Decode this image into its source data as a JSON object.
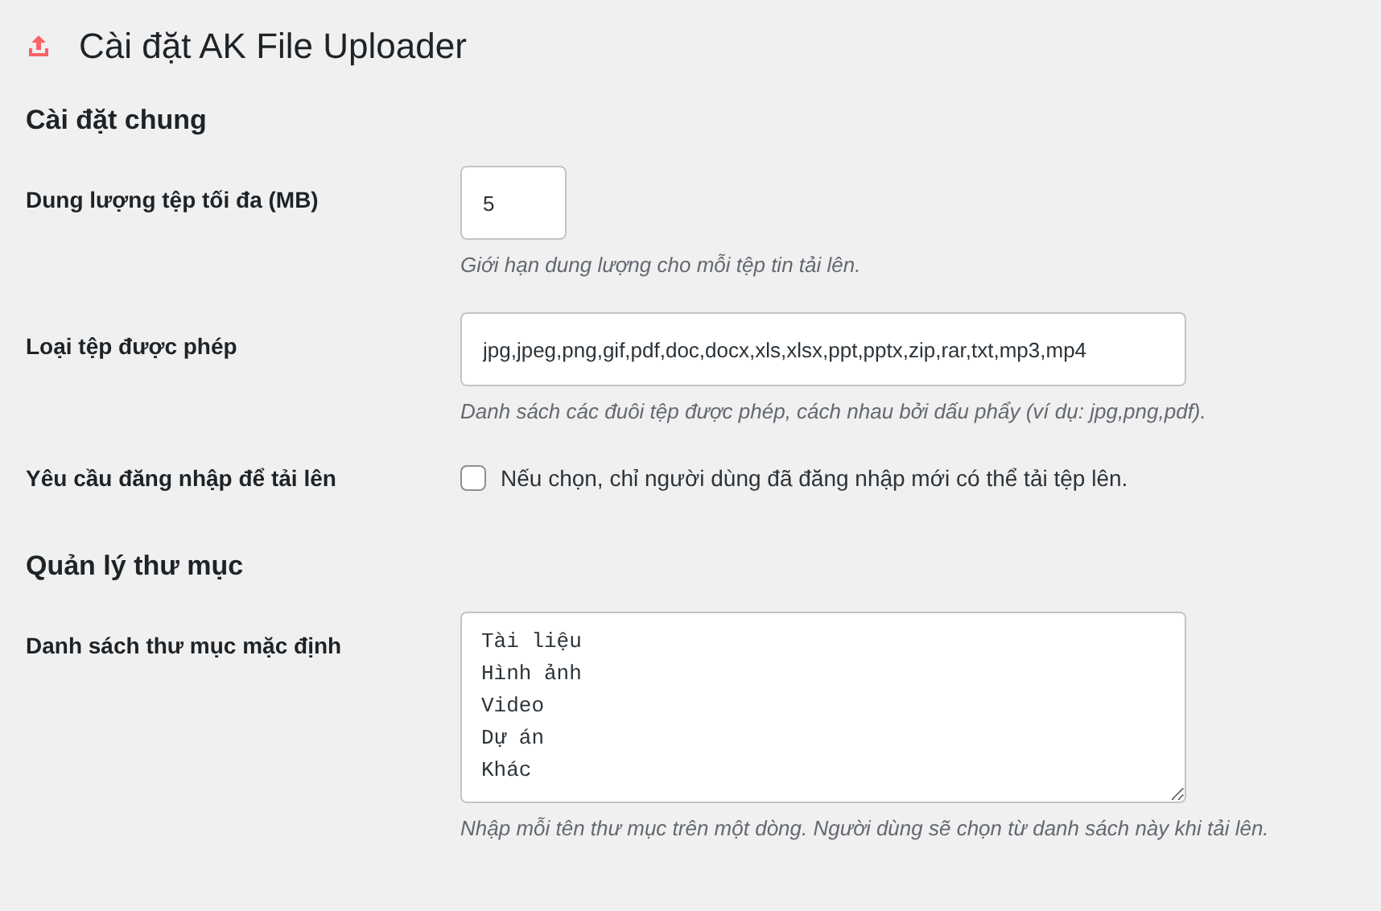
{
  "title": "Cài đặt AK File Uploader",
  "sections": [
    {
      "heading": "Cài đặt chung",
      "fields": [
        {
          "kind": "number",
          "label": "Dung lượng tệp tối đa (MB)",
          "value": "5",
          "description": "Giới hạn dung lượng cho mỗi tệp tin tải lên."
        },
        {
          "kind": "text",
          "label": "Loại tệp được phép",
          "value": "jpg,jpeg,png,gif,pdf,doc,docx,xls,xlsx,ppt,pptx,zip,rar,txt,mp3,mp4",
          "description": "Danh sách các đuôi tệp được phép, cách nhau bởi dấu phẩy (ví dụ: jpg,png,pdf)."
        },
        {
          "kind": "checkbox",
          "label": "Yêu cầu đăng nhập để tải lên",
          "checked": false,
          "text": "Nếu chọn, chỉ người dùng đã đăng nhập mới có thể tải tệp lên."
        }
      ]
    },
    {
      "heading": "Quản lý thư mục",
      "fields": [
        {
          "kind": "textarea",
          "label": "Danh sách thư mục mặc định",
          "lines": [
            "Tài liệu",
            "Hình ảnh",
            "Video",
            "Dự án",
            "Khác"
          ],
          "description": "Nhập mỗi tên thư mục trên một dòng. Người dùng sẽ chọn từ danh sách này khi tải lên."
        }
      ]
    }
  ]
}
